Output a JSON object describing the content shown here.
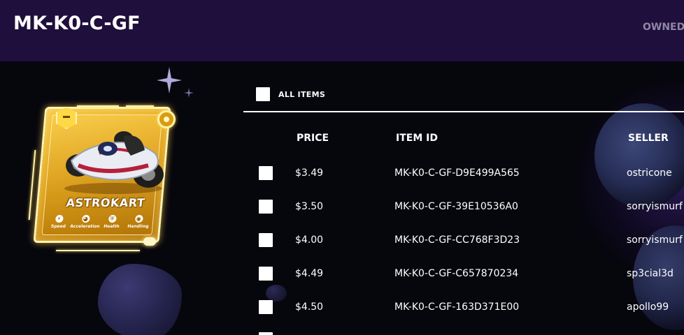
{
  "header": {
    "title": "MK-K0-C-GF",
    "owned_tab": "OWNED"
  },
  "card": {
    "name": "ASTROKART",
    "stats": [
      {
        "label": "Speed",
        "icon": "lightning-icon"
      },
      {
        "label": "Acceleration",
        "icon": "gauge-icon"
      },
      {
        "label": "Health",
        "icon": "shield-icon"
      },
      {
        "label": "Handling",
        "icon": "steering-wheel-icon"
      }
    ]
  },
  "table": {
    "select_all_label": "ALL ITEMS",
    "columns": {
      "price": "PRICE",
      "item_id": "ITEM ID",
      "seller": "SELLER"
    },
    "rows": [
      {
        "price": "$3.49",
        "item_id": "MK-K0-C-GF-D9E499A565",
        "seller": "ostricone"
      },
      {
        "price": "$3.50",
        "item_id": "MK-K0-C-GF-39E10536A0",
        "seller": "sorryismurf"
      },
      {
        "price": "$4.00",
        "item_id": "MK-K0-C-GF-CC768F3D23",
        "seller": "sorryismurf"
      },
      {
        "price": "$4.49",
        "item_id": "MK-K0-C-GF-C657870234",
        "seller": "sp3cial3d"
      },
      {
        "price": "$4.50",
        "item_id": "MK-K0-C-GF-163D371E00",
        "seller": "apollo99"
      }
    ]
  },
  "colors": {
    "header_bg": "#1e0f3c",
    "page_bg": "#06060d",
    "card_gold": "#e3a315",
    "muted_tab": "#8e87a6"
  }
}
